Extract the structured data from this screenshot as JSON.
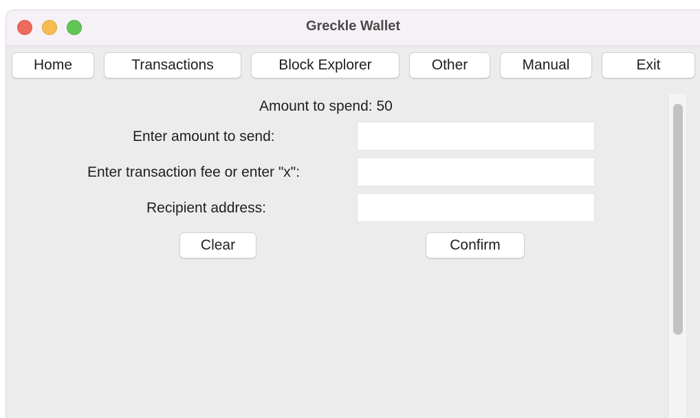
{
  "window": {
    "title": "Greckle Wallet"
  },
  "nav": {
    "items": [
      {
        "label": "Home"
      },
      {
        "label": "Transactions"
      },
      {
        "label": "Block Explorer"
      },
      {
        "label": "Other"
      },
      {
        "label": "Manual"
      },
      {
        "label": "Exit"
      }
    ]
  },
  "form": {
    "balance_text": "Amount to spend: 50",
    "amount_label": "Enter amount to send:",
    "amount_value": "",
    "fee_label": "Enter transaction fee or enter \"x\":",
    "fee_value": "",
    "recipient_label": "Recipient address:",
    "recipient_value": "",
    "clear_label": "Clear",
    "confirm_label": "Confirm"
  },
  "colors": {
    "close": "#ee6a5e",
    "minimize": "#f5bd4f",
    "maximize": "#61c554",
    "window_bg": "#ececec"
  }
}
